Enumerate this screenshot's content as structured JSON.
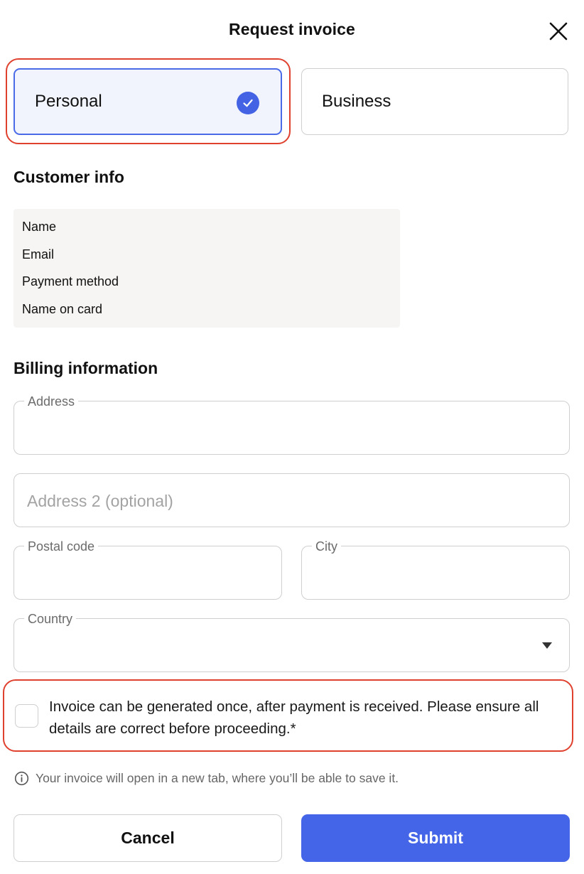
{
  "dialog": {
    "title": "Request invoice",
    "close_icon": "close-icon"
  },
  "invoice_type": {
    "options": [
      {
        "label": "Personal",
        "selected": true
      },
      {
        "label": "Business",
        "selected": false
      }
    ],
    "selected_icon": "check-circle-icon"
  },
  "customer_info": {
    "title": "Customer info",
    "rows": [
      "Name",
      "Email",
      "Payment method",
      "Name on card"
    ]
  },
  "billing": {
    "title": "Billing information",
    "address": {
      "label": "Address",
      "value": ""
    },
    "address2": {
      "placeholder": "Address 2 (optional)",
      "value": ""
    },
    "postal_code": {
      "label": "Postal code",
      "value": ""
    },
    "city": {
      "label": "City",
      "value": ""
    },
    "country": {
      "label": "Country",
      "value": "",
      "icon": "caret-down-icon"
    }
  },
  "consent": {
    "checked": false,
    "text": "Invoice can be generated once, after payment is received. Please ensure all details are correct before proceeding.*"
  },
  "note": {
    "icon": "info-icon",
    "text": "Your invoice will open in a new tab, where you’ll be able to save it."
  },
  "actions": {
    "cancel_label": "Cancel",
    "submit_label": "Submit"
  },
  "colors": {
    "accent": "#4565e8",
    "selected_bg": "#f1f4fd",
    "highlight": "#e0412f",
    "info_box_bg": "#f6f5f3",
    "border": "#cfcfcf"
  }
}
